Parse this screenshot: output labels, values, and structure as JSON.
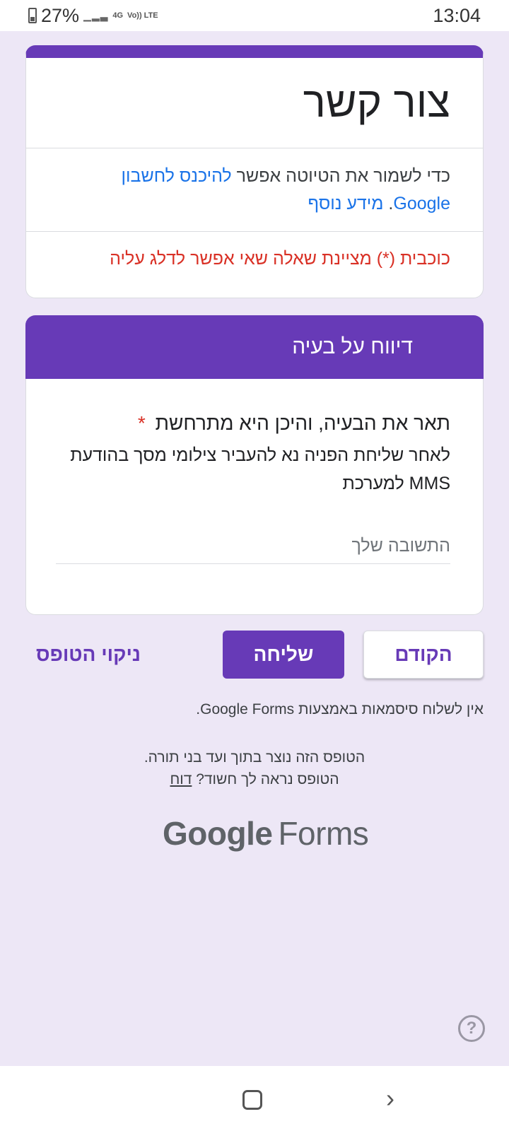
{
  "status_bar": {
    "battery_percent": "27%",
    "network_4g": "4G",
    "network_lte": "Vo)) LTE",
    "time": "13:04"
  },
  "form": {
    "title": "צור קשר",
    "signin_text": "כדי לשמור את הטיוטה אפשר",
    "signin_link": "להיכנס לחשבון Google",
    "learn_more": "מידע נוסף",
    "required_note": "כוכבית (*) מציינת שאלה שאי אפשר לדלג עליה"
  },
  "section": {
    "title": "דיווח על בעיה"
  },
  "question": {
    "title": "תאר את הבעיה, והיכן היא מתרחשת",
    "required_marker": "*",
    "description": "לאחר שליחת הפניה נא להעביר צילומי מסך בהודעת MMS למערכת",
    "answer_placeholder": "התשובה שלך"
  },
  "buttons": {
    "back": "הקודם",
    "submit": "שליחה",
    "clear": "ניקוי הטופס"
  },
  "footer": {
    "password_note": "אין לשלוח סיסמאות באמצעות Google Forms.",
    "created_note": "הטופס הזה נוצר בתוך ועד בני תורה.",
    "suspicious_note": "הטופס נראה לך חשוד?",
    "report_link": "דוח",
    "logo_google": "Google",
    "logo_forms": "Forms"
  },
  "help_icon": "question-circle-icon",
  "colors": {
    "accent": "#673ab7",
    "background": "#ede7f6",
    "error": "#d93025",
    "link": "#1a73e8"
  }
}
